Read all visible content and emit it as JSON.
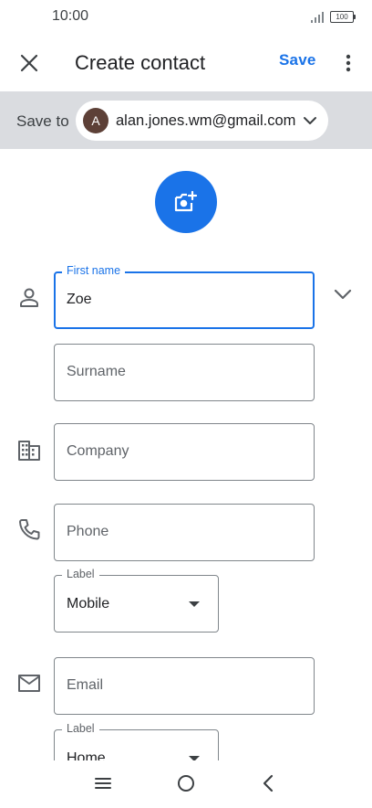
{
  "status_bar": {
    "time": "10:00",
    "battery": "100"
  },
  "app_bar": {
    "title": "Create contact",
    "save_label": "Save"
  },
  "account": {
    "save_to_label": "Save to",
    "avatar_initial": "A",
    "email": "alan.jones.wm@gmail.com"
  },
  "form": {
    "first_name": {
      "label": "First name",
      "value": "Zoe"
    },
    "surname": {
      "placeholder": "Surname"
    },
    "company": {
      "placeholder": "Company"
    },
    "phone": {
      "placeholder": "Phone"
    },
    "phone_label": {
      "label": "Label",
      "value": "Mobile"
    },
    "email": {
      "placeholder": "Email"
    },
    "email_label": {
      "label": "Label",
      "value": "Home"
    }
  },
  "colors": {
    "accent": "#1a73e8",
    "avatar": "#5d4037",
    "account_bar": "#dadce0"
  },
  "icons": [
    "close-icon",
    "more-vert-icon",
    "chevron-down-icon",
    "add-photo-icon",
    "person-icon",
    "business-icon",
    "phone-icon",
    "email-icon",
    "expand-more-icon",
    "nav-menu-icon",
    "nav-home-icon",
    "nav-back-icon"
  ]
}
